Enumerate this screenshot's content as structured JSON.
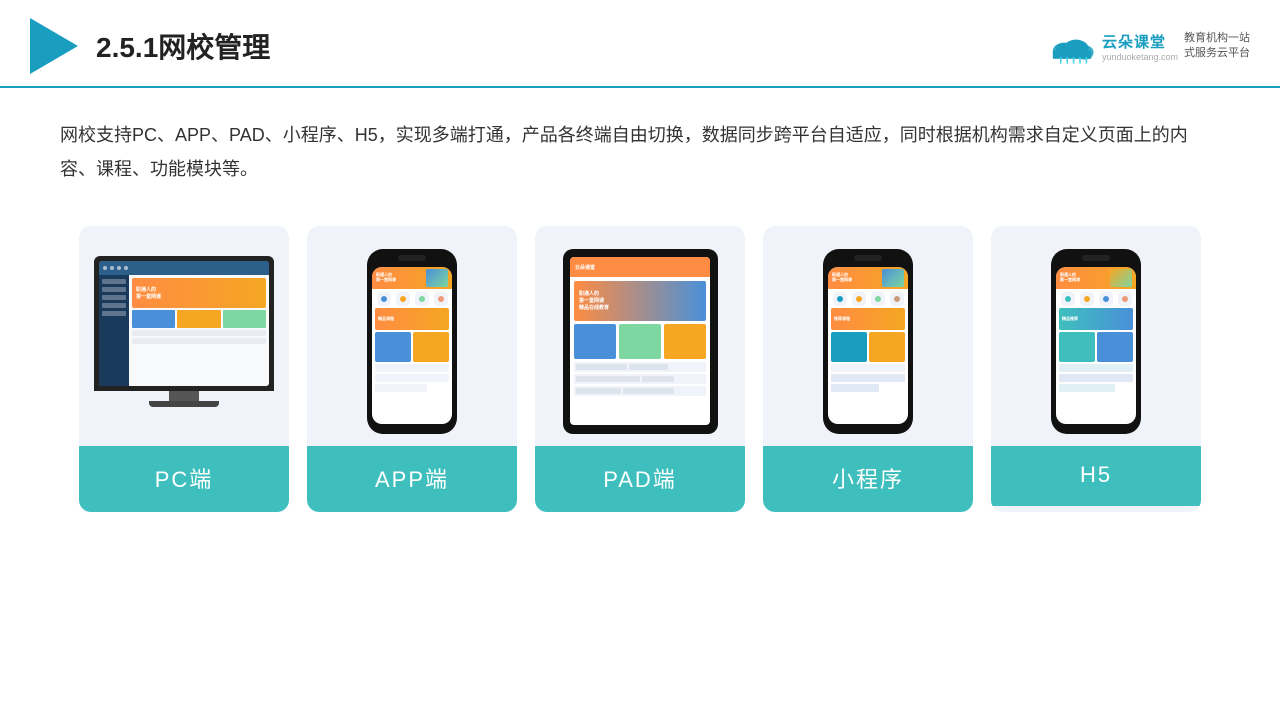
{
  "header": {
    "title": "2.5.1网校管理",
    "logo": {
      "main_text": "云朵课堂",
      "sub_url": "yunduoketang.com",
      "slogan_line1": "教育机构一站",
      "slogan_line2": "式服务云平台"
    }
  },
  "description": {
    "text": "网校支持PC、APP、PAD、小程序、H5，实现多端打通，产品各终端自由切换，数据同步跨平台自适应，同时根据机构需求自定义页面上的内容、课程、功能模块等。"
  },
  "cards": [
    {
      "id": "pc",
      "label": "PC端"
    },
    {
      "id": "app",
      "label": "APP端"
    },
    {
      "id": "pad",
      "label": "PAD端"
    },
    {
      "id": "miniapp",
      "label": "小程序"
    },
    {
      "id": "h5",
      "label": "H5"
    }
  ],
  "colors": {
    "teal": "#3ebfbd",
    "accent_blue": "#1a9ec0",
    "card_bg": "#f0f4fa"
  }
}
